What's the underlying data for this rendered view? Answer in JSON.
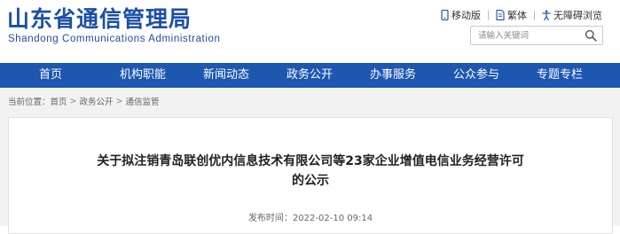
{
  "header": {
    "site_title": "山东省通信管理局",
    "site_subtitle": "Shandong Communications Administration",
    "links": {
      "mobile": "移动版",
      "traditional": "繁体",
      "accessible": "无障碍浏览"
    },
    "search": {
      "placeholder": "请输入关键词"
    }
  },
  "nav": {
    "items": [
      {
        "label": "首页"
      },
      {
        "label": "机构职能"
      },
      {
        "label": "新闻动态"
      },
      {
        "label": "政务公开"
      },
      {
        "label": "办事服务"
      },
      {
        "label": "公众参与"
      },
      {
        "label": "专题专栏"
      }
    ]
  },
  "breadcrumb": {
    "prefix": "当前位置：",
    "items": [
      "首页",
      "政务公开",
      "通信监管"
    ],
    "separator": ">"
  },
  "article": {
    "title_line1": "关于拟注销青岛联创优内信息技术有限公司等23家企业增值电信业务经营许可",
    "title_line2": "的公示",
    "publish_label": "发布时间：",
    "publish_date": "2022-02-10 09:14"
  },
  "colors": {
    "brand": "#1d57b0",
    "logo_text": "#1b4fa6",
    "page_bg": "#f2f2f2"
  },
  "icons": {
    "mobile": "mobile-phone-icon",
    "traditional": "document-icon",
    "accessible": "accessibility-icon",
    "search": "search-icon"
  }
}
